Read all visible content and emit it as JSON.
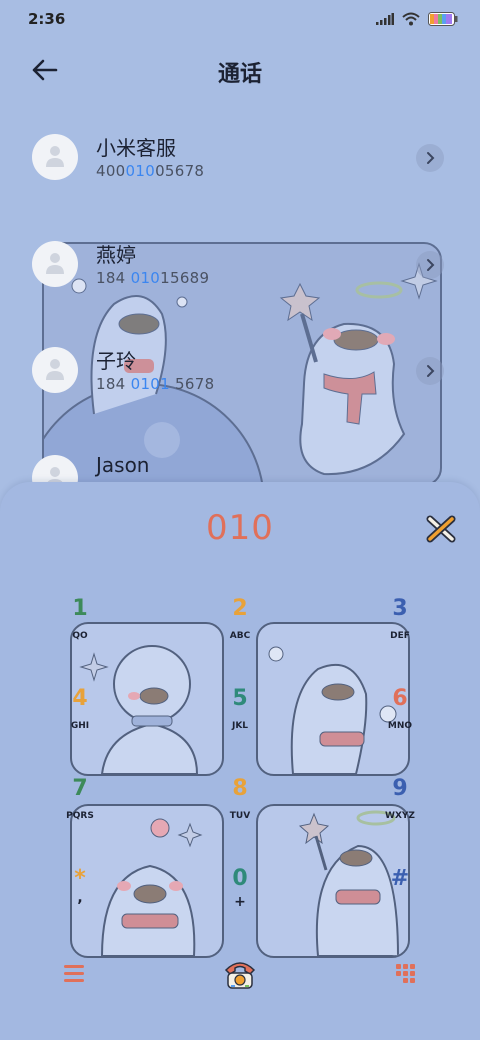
{
  "status": {
    "time": "2:36"
  },
  "header": {
    "title": "通话"
  },
  "contacts": [
    {
      "name": "小米客服",
      "num_pre": "400",
      "num_hl": "010",
      "num_post": "05678"
    },
    {
      "name": "燕婷",
      "num_pre": "184 ",
      "num_hl": "010",
      "num_post": "15689"
    },
    {
      "name": "子玲",
      "num_pre": "184 ",
      "num_hl": "0101",
      "num_post": " 5678"
    },
    {
      "name": "Jason"
    }
  ],
  "dialer": {
    "dialed": "010",
    "keys": [
      {
        "digit": "1",
        "letters": "QO",
        "color": "#3d8a5a"
      },
      {
        "digit": "2",
        "letters": "ABC",
        "color": "#e8a23a"
      },
      {
        "digit": "3",
        "letters": "DEF",
        "color": "#3b5fb0"
      },
      {
        "digit": "4",
        "letters": "GHI",
        "color": "#e8a23a"
      },
      {
        "digit": "5",
        "letters": "JKL",
        "color": "#2f8a7a"
      },
      {
        "digit": "6",
        "letters": "MNO",
        "color": "#e0705a"
      },
      {
        "digit": "7",
        "letters": "PQRS",
        "color": "#3d8a5a"
      },
      {
        "digit": "8",
        "letters": "TUV",
        "color": "#e8a23a"
      },
      {
        "digit": "9",
        "letters": "WXYZ",
        "color": "#3b5fb0"
      },
      {
        "digit": "*",
        "letters": ",",
        "color": "#e8a23a"
      },
      {
        "digit": "0",
        "letters": "+",
        "color": "#2f8a7a"
      },
      {
        "digit": "#",
        "letters": "",
        "color": "#3b5fb0"
      }
    ]
  },
  "colors": {
    "accent": "#e0705a",
    "highlight": "#3b86f0",
    "background": "#a8bde3"
  },
  "icons": {
    "back": "arrow-left-icon",
    "delete": "backspace-x-icon",
    "menu": "menu-icon",
    "call": "telephone-icon",
    "keypad": "keypad-icon"
  }
}
